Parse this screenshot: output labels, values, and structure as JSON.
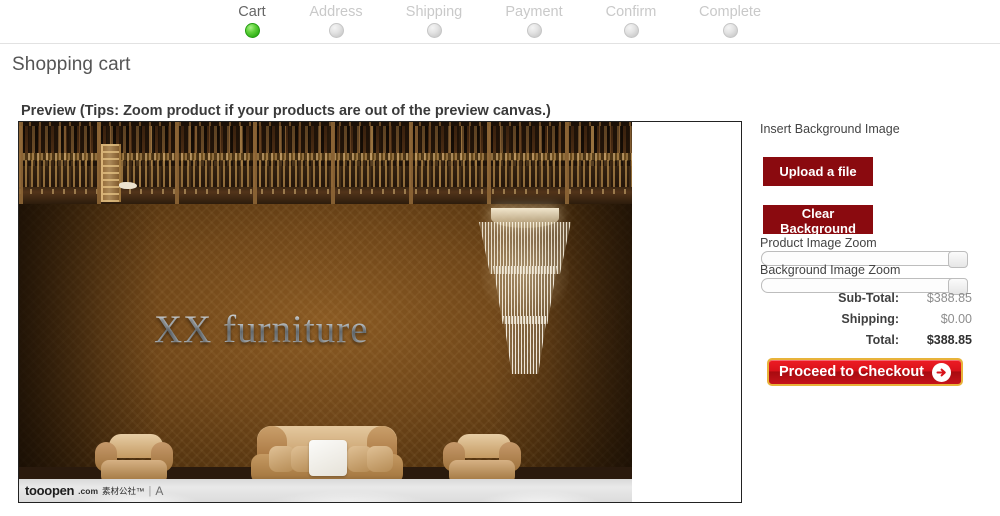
{
  "steps": [
    {
      "label": "Cart",
      "state": "active"
    },
    {
      "label": "Address",
      "state": "inactive"
    },
    {
      "label": "Shipping",
      "state": "inactive"
    },
    {
      "label": "Payment",
      "state": "inactive"
    },
    {
      "label": "Confirm",
      "state": "inactive"
    },
    {
      "label": "Complete",
      "state": "inactive"
    }
  ],
  "page": {
    "title": "Shopping cart",
    "preview_heading": "Preview (Tips: Zoom product if your products are out of the preview canvas.)"
  },
  "preview": {
    "wall_text": "XX  furniture",
    "watermark": {
      "brand": "tooopen",
      "domain": ".com",
      "chinese": "素材公社™",
      "separator": "|",
      "suffix": "A"
    }
  },
  "side_panel": {
    "insert_background_label": "Insert Background Image",
    "upload_button": "Upload a file",
    "clear_background_button": "Clear Background",
    "product_zoom_label": "Product Image Zoom",
    "background_zoom_label": "Background Image Zoom",
    "product_zoom_value": "100",
    "background_zoom_value": "100"
  },
  "totals": [
    {
      "label": "Sub-Total:",
      "value": "$388.85",
      "kind": "normal"
    },
    {
      "label": "Shipping:",
      "value": "$0.00",
      "kind": "normal"
    },
    {
      "label": "Total:",
      "value": "$388.85",
      "kind": "grand"
    }
  ],
  "checkout": {
    "button_label": "Proceed to Checkout",
    "arrow_icon": "arrow-right-circle-icon"
  },
  "colors": {
    "accent_dark_red": "#8a0a0f",
    "checkout_red": "#d8121a",
    "checkout_border_gold": "#e8b33a",
    "active_step_green": "#2fae17"
  }
}
